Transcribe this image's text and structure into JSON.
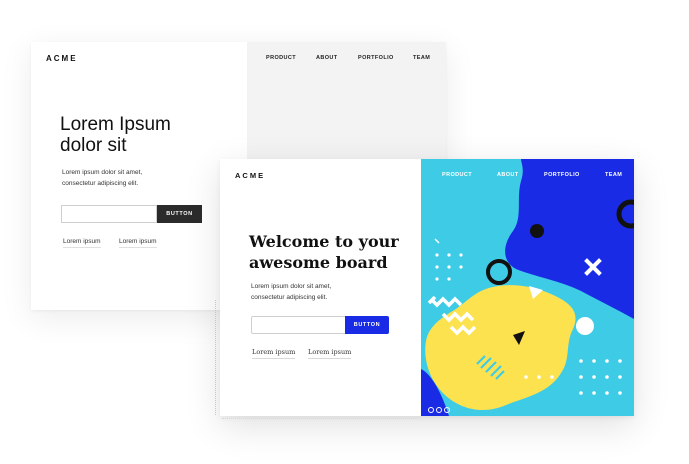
{
  "back_card": {
    "logo": "ACME",
    "nav": [
      "PRODUCT",
      "ABOUT",
      "PORTFOLIO",
      "TEAM"
    ],
    "title_line1": "Lorem Ipsum",
    "title_line2": "dolor sit",
    "subtitle_line1": "Lorem ipsum dolor sit amet,",
    "subtitle_line2": "consectetur adipiscing elit.",
    "input_placeholder": "",
    "button_label": "BUTTON",
    "links": [
      "Lorem ipsum",
      "Lorem ipsum"
    ]
  },
  "front_card": {
    "logo": "ACME",
    "nav": [
      "PRODUCT",
      "ABOUT",
      "PORTFOLIO",
      "TEAM"
    ],
    "title_line1": "Welcome to your",
    "title_line2": "awesome board",
    "subtitle_line1": "Lorem ipsum dolor sit amet,",
    "subtitle_line2": "consectetur adipiscing elit.",
    "input_placeholder": "",
    "button_label": "BUTTON",
    "links": [
      "Lorem ipsum",
      "Lorem ipsum"
    ],
    "art_colors": {
      "cyan": "#3ecbe6",
      "blue": "#1a2be6",
      "yellow": "#fde24f",
      "black": "#111111",
      "white": "#ffffff"
    }
  }
}
